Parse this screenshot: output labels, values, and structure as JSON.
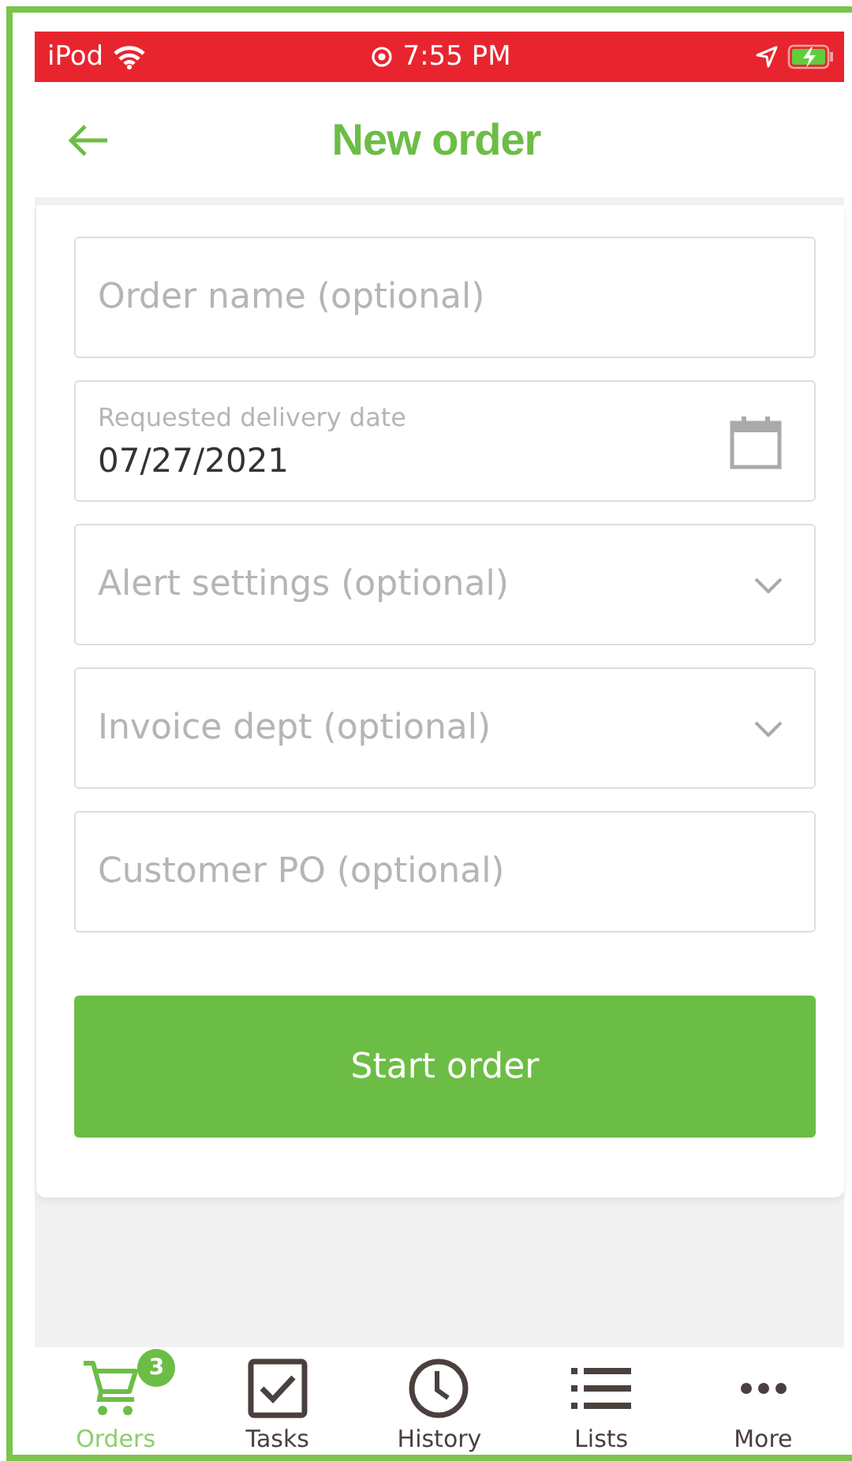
{
  "status_bar": {
    "device": "iPod",
    "time": "7:55 PM"
  },
  "header": {
    "title": "New order"
  },
  "fields": [
    {
      "kind": "text",
      "placeholder": "Order name (optional)"
    },
    {
      "kind": "date",
      "label": "Requested delivery date",
      "value": "07/27/2021"
    },
    {
      "kind": "select",
      "placeholder": "Alert settings (optional)"
    },
    {
      "kind": "select",
      "placeholder": "Invoice dept (optional)"
    },
    {
      "kind": "text",
      "placeholder": "Customer PO (optional)"
    }
  ],
  "start_button": "Start order",
  "tabs": [
    {
      "kind": "cart",
      "label": "Orders",
      "selected": true,
      "badge": "3"
    },
    {
      "kind": "tasks",
      "label": "Tasks",
      "selected": false
    },
    {
      "kind": "history",
      "label": "History",
      "selected": false
    },
    {
      "kind": "lists",
      "label": "Lists",
      "selected": false
    },
    {
      "kind": "more",
      "label": "More",
      "selected": false
    }
  ]
}
